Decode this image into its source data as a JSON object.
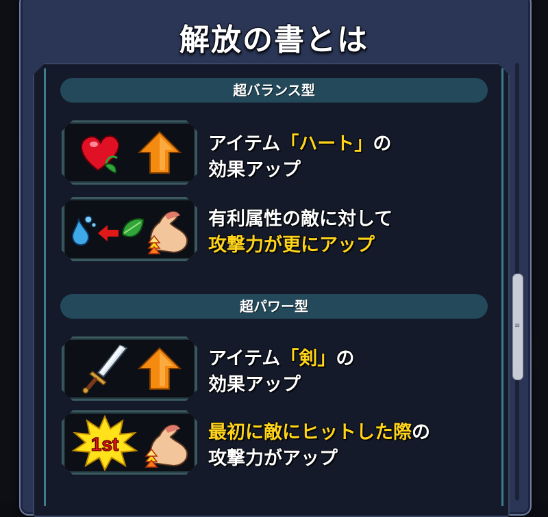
{
  "title": "解放の書とは",
  "sections": [
    {
      "header": "超バランス型",
      "items": [
        {
          "icon_names": [
            "heart-item-icon",
            "up-arrow-icon"
          ],
          "line1": [
            {
              "text": "アイテム",
              "hl": false
            },
            {
              "text": "「ハート」",
              "hl": true
            },
            {
              "text": "の",
              "hl": false
            }
          ],
          "line2": [
            {
              "text": "効果アップ",
              "hl": false
            }
          ]
        },
        {
          "icon_names": [
            "water-element-icon",
            "advantage-arrow-icon",
            "wood-element-icon",
            "attack-up-arm-icon"
          ],
          "line1": [
            {
              "text": "有利属性の敵に対して",
              "hl": false
            }
          ],
          "line2": [
            {
              "text": "攻撃力が更にアップ",
              "hl": true
            }
          ]
        }
      ]
    },
    {
      "header": "超パワー型",
      "items": [
        {
          "icon_names": [
            "sword-item-icon",
            "up-arrow-icon"
          ],
          "line1": [
            {
              "text": "アイテム",
              "hl": false
            },
            {
              "text": "「剣」",
              "hl": true
            },
            {
              "text": "の",
              "hl": false
            }
          ],
          "line2": [
            {
              "text": "効果アップ",
              "hl": false
            }
          ]
        },
        {
          "icon_names": [
            "first-hit-burst-icon",
            "attack-up-arm-icon"
          ],
          "icon_text": "1st",
          "line1": [
            {
              "text": "最初に敵にヒットした際",
              "hl": true
            },
            {
              "text": "の",
              "hl": false
            }
          ],
          "line2": [
            {
              "text": "攻撃力がアップ",
              "hl": false
            }
          ]
        }
      ]
    }
  ],
  "colors": {
    "highlight": "#ffd41a",
    "text": "#ffffff",
    "panel": "#2b3656",
    "header_pill": "#24495a"
  }
}
